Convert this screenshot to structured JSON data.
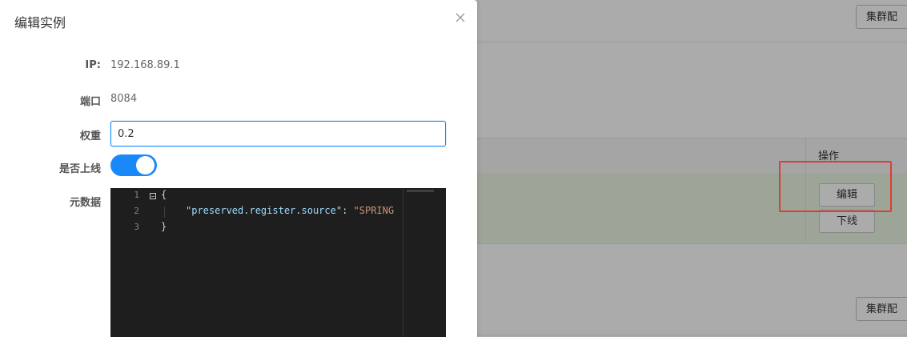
{
  "background": {
    "cluster_button_top": "集群配",
    "cluster_button_bottom": "集群配",
    "table": {
      "ops_header": "操作",
      "edit_button": "编辑",
      "offline_button": "下线"
    }
  },
  "modal": {
    "title": "编辑实例",
    "fields": {
      "ip_label": "IP:",
      "ip_value": "192.168.89.1",
      "port_label": "端口",
      "port_value": "8084",
      "weight_label": "权重",
      "weight_value": "0.2",
      "online_label": "是否上线",
      "online_enabled": true,
      "metadata_label": "元数据"
    },
    "editor": {
      "line_numbers": [
        "1",
        "2",
        "3"
      ],
      "line1": "{",
      "line2_key": "\"preserved.register.source\"",
      "line2_sep": ": ",
      "line2_value": "\"SPRING",
      "line3": "}"
    }
  },
  "colors": {
    "accent": "#1989fa",
    "highlight": "#e23c2f",
    "editor_bg": "#1e1e1e"
  }
}
